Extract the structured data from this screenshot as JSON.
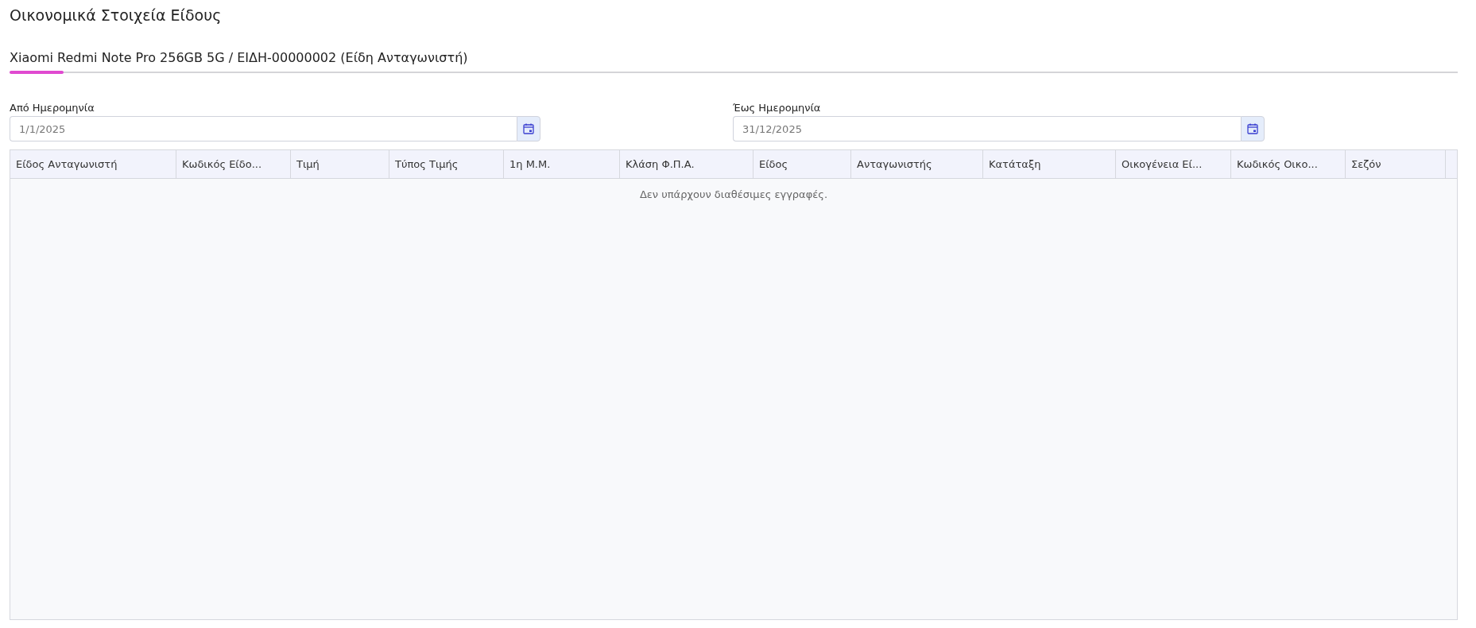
{
  "page": {
    "title": "Οικονομικά Στοιχεία Είδους"
  },
  "tabs": [
    {
      "label": "Xiaomi Redmi Note Pro 256GB 5G / ΕΙΔΗ-00000002 (Είδη Ανταγωνιστή)",
      "selected": true
    }
  ],
  "filters": [
    {
      "label": "Από Ημερομηνία",
      "value": "1/1/2025"
    },
    {
      "label": "Έως Ημερομηνία",
      "value": "31/12/2025"
    }
  ],
  "table": {
    "columns": [
      "Είδος Ανταγωνιστή",
      "Κωδικός Είδο...",
      "Τιμή",
      "Τύπος Τιμής",
      "1η Μ.Μ.",
      "Κλάση Φ.Π.Α.",
      "Είδος",
      "Ανταγωνιστής",
      "Κατάταξη",
      "Οικογένεια Εί...",
      "Κωδικός Οικο...",
      "Σεζόν"
    ],
    "empty_message": "Δεν υπάρχουν διαθέσιμες εγγραφές."
  }
}
